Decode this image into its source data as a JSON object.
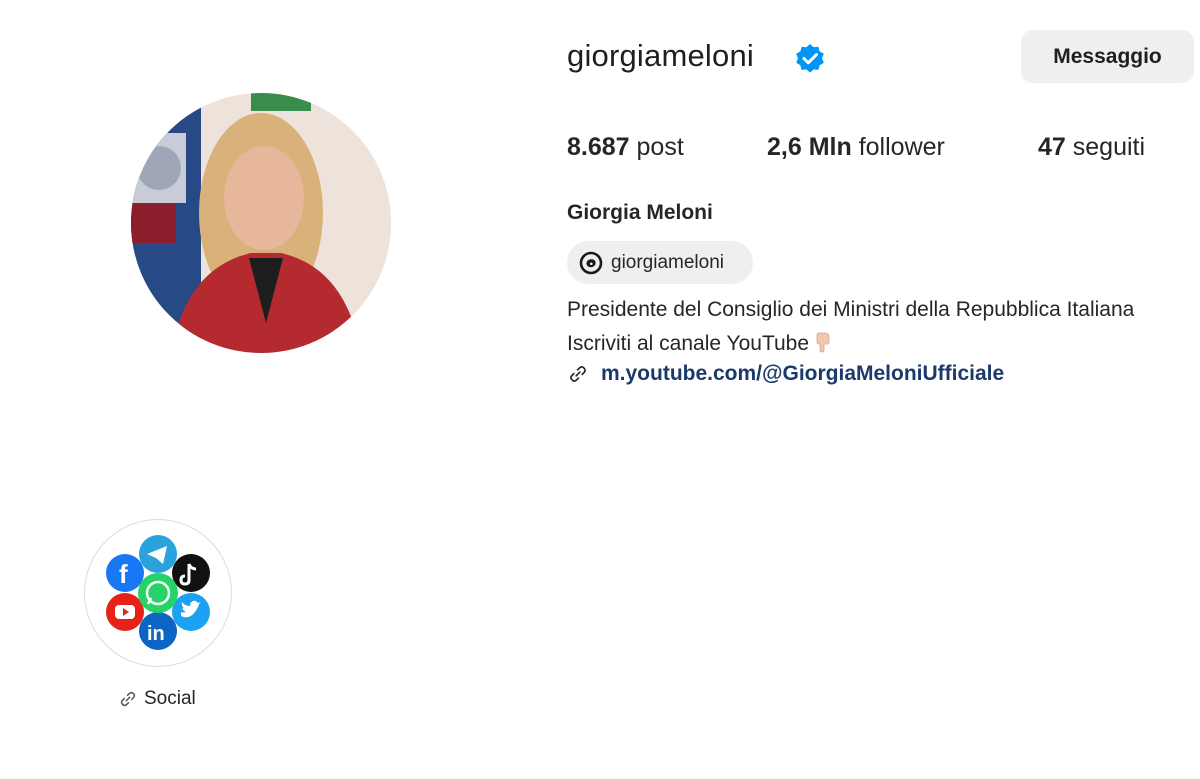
{
  "profile": {
    "username": "giorgiameloni",
    "verified": true,
    "message_button": "Messaggio",
    "full_name": "Giorgia Meloni",
    "threads_handle": "giorgiameloni",
    "avatar_icon": "profile-photo"
  },
  "stats": {
    "posts_value": "8.687",
    "posts_label": "post",
    "followers_value": "2,6 Mln",
    "followers_label": "follower",
    "following_value": "47",
    "following_label": "seguiti"
  },
  "bio": {
    "line1": "Presidente del Consiglio dei Ministri della Repubblica Italiana",
    "line2": "Iscriviti al canale YouTube",
    "link": "m.youtube.com/@GiorgiaMeloniUfficiale"
  },
  "highlights": [
    {
      "label": "Social"
    }
  ],
  "colors": {
    "verified_blue": "#0095f6",
    "link_text": "#1b3a6b",
    "button_bg": "#efefef"
  }
}
